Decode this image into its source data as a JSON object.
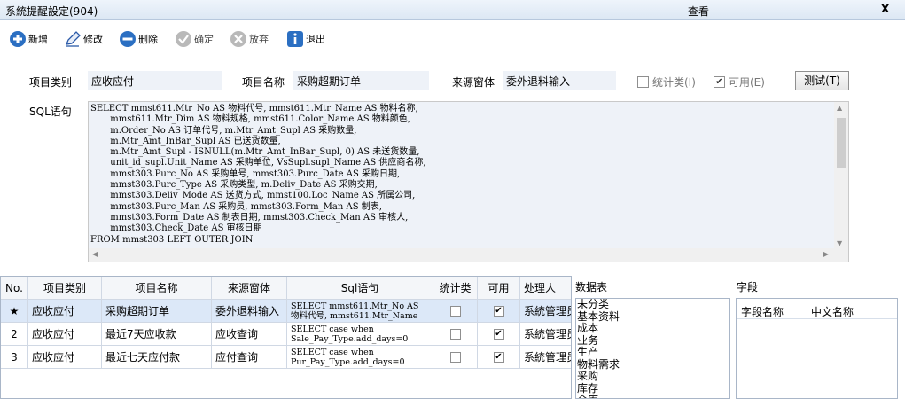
{
  "window": {
    "title": "系統提醒設定(904)",
    "mode": "查看",
    "close_label": "X"
  },
  "toolbar": {
    "new_label": "新增",
    "edit_label": "修改",
    "delete_label": "删除",
    "confirm_label": "确定",
    "discard_label": "放弃",
    "exit_label": "退出"
  },
  "form": {
    "category_label": "项目类别",
    "category_value": "应收应付",
    "name_label": "项目名称",
    "name_value": "采购超期订单",
    "source_label": "来源窗体",
    "source_value": "委外退料输入",
    "stat_label": "统计类(I)",
    "stat_checked": false,
    "enabled_label": "可用(E)",
    "enabled_checked": true,
    "test_button": "测试(T)",
    "sql_label": "SQL语句",
    "sql_text": "SELECT mmst611.Mtr_No AS 物料代号, mmst611.Mtr_Name AS 物料名称,\n       mmst611.Mtr_Dim AS 物料规格, mmst611.Color_Name AS 物料颜色,\n       m.Order_No AS 订单代号, m.Mtr_Amt_Supl AS 采购数量,\n       m.Mtr_Amt_InBar_Supl AS 已送货数量,\n       m.Mtr_Amt_Supl - ISNULL(m.Mtr_Amt_InBar_Supl, 0) AS 未送货数量,\n       unit_id_supl.Unit_Name AS 采购单位, VsSupl.supl_Name AS 供应商名称,\n       mmst303.Purc_No AS 采购单号, mmst303.Purc_Date AS 采购日期,\n       mmst303.Purc_Type AS 采购类型, m.Deliv_Date AS 采购交期,\n       mmst303.Deliv_Mode AS 送货方式, mmst100.Loc_Name AS 所属公司,\n       mmst303.Purc_Man AS 采购员, mmst303.Form_Man AS 制表,\n       mmst303.Form_Date AS 制表日期, mmst303.Check_Man AS 审核人,\n       mmst303.Check_Date AS 审核日期\nFROM mmst303 LEFT OUTER JOIN"
  },
  "grid": {
    "headers": [
      "No.",
      "项目类别",
      "项目名称",
      "来源窗体",
      "Sql语句",
      "统计类",
      "可用",
      "处理人"
    ],
    "rows": [
      {
        "no": "★",
        "category": "应收应付",
        "name": "采购超期订单",
        "source": "委外退料输入",
        "sql": "SELECT mmst611.Mtr_No AS\n物料代号, mmst611.Mtr_Name",
        "stat": false,
        "enabled": true,
        "handler": "系統管理员"
      },
      {
        "no": "2",
        "category": "应收应付",
        "name": "最近7天应收款",
        "source": "应收查询",
        "sql": "SELECT case when\nSale_Pay_Type.add_days=0",
        "stat": false,
        "enabled": true,
        "handler": "系統管理员"
      },
      {
        "no": "3",
        "category": "应收应付",
        "name": "最近七天应付款",
        "source": "应付查询",
        "sql": "SELECT case when\nPur_Pay_Type.add_days=0",
        "stat": false,
        "enabled": true,
        "handler": "系統管理员"
      }
    ]
  },
  "tables_panel": {
    "title": "数据表",
    "items": [
      "未分类",
      "基本资料",
      "成本",
      "业务",
      "生产",
      "物料需求",
      "采购",
      "库存",
      "仓库"
    ]
  },
  "fields_panel": {
    "title": "字段",
    "col_name": "字段名称",
    "col_cn_name": "中文名称"
  }
}
